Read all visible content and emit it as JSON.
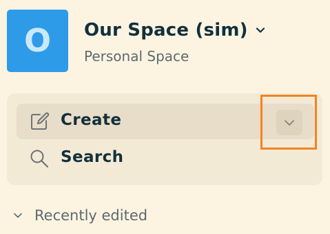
{
  "space": {
    "avatar_letter": "O",
    "title": "Our Space (sim)",
    "subtitle": "Personal Space",
    "avatar_color": "#2e9be8"
  },
  "actions": {
    "create_label": "Create",
    "search_label": "Search",
    "create_icon": "pencil-square-icon",
    "search_icon": "magnifier-icon",
    "dropdown_icon": "chevron-down-icon"
  },
  "sections": {
    "recent_label": "Recently edited"
  },
  "colors": {
    "background": "#fcf4e1",
    "text": "#12303c",
    "muted": "#5d6a70",
    "highlight": "#f58220"
  }
}
